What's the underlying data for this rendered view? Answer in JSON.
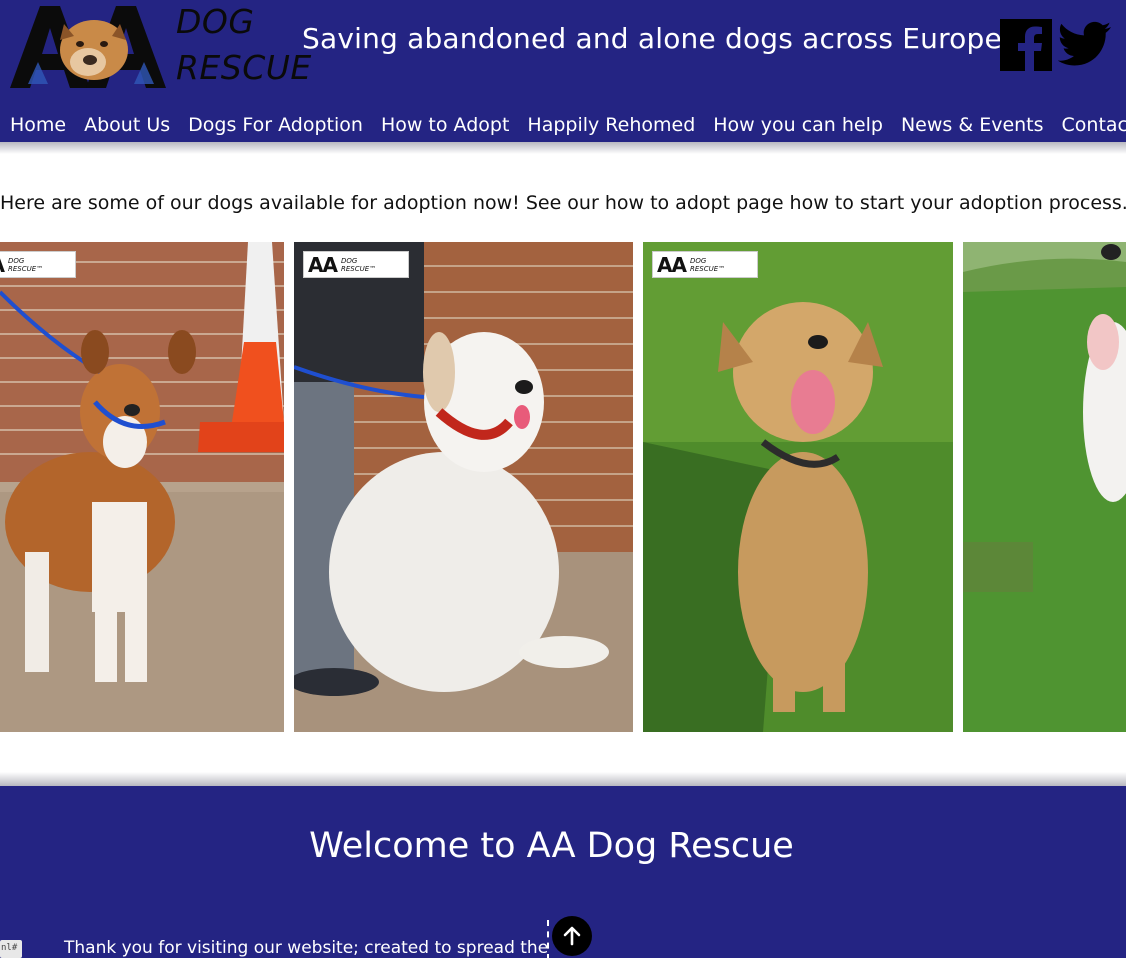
{
  "header": {
    "logo": {
      "letters": "AA",
      "line1": "DOG",
      "line2": "RESCUE"
    },
    "tagline": "Saving abandoned and alone dogs across Europe",
    "social": [
      {
        "name": "facebook",
        "icon": "facebook-icon"
      },
      {
        "name": "twitter",
        "icon": "twitter-icon"
      }
    ]
  },
  "nav": {
    "items": [
      {
        "label": "Home"
      },
      {
        "label": "About Us"
      },
      {
        "label": "Dogs For Adoption"
      },
      {
        "label": "How to Adopt"
      },
      {
        "label": "Happily Rehomed"
      },
      {
        "label": "How you can help"
      },
      {
        "label": "News & Events"
      },
      {
        "label": "Contact Us"
      }
    ]
  },
  "intro": "Here are some of our dogs available for adoption now! See our how to adopt page how to start your adoption process.",
  "dogs": [
    {
      "watermark_letters": "AA",
      "watermark_line1": "DOG",
      "watermark_line2": "RESCUE™"
    },
    {
      "watermark_letters": "AA",
      "watermark_line1": "DOG",
      "watermark_line2": "RESCUE™"
    },
    {
      "watermark_letters": "AA",
      "watermark_line1": "DOG",
      "watermark_line2": "RESCUE™"
    },
    {
      "watermark_letters": "",
      "watermark_line1": "",
      "watermark_line2": ""
    }
  ],
  "welcome": {
    "title": "Welcome to AA Dog Rescue",
    "text": "Thank you for visiting our website; created to spread the",
    "back_to_top_icon": "arrow-up-icon",
    "corner_tag": "nl#"
  },
  "colors": {
    "brand_navy": "#242483",
    "white": "#ffffff"
  }
}
